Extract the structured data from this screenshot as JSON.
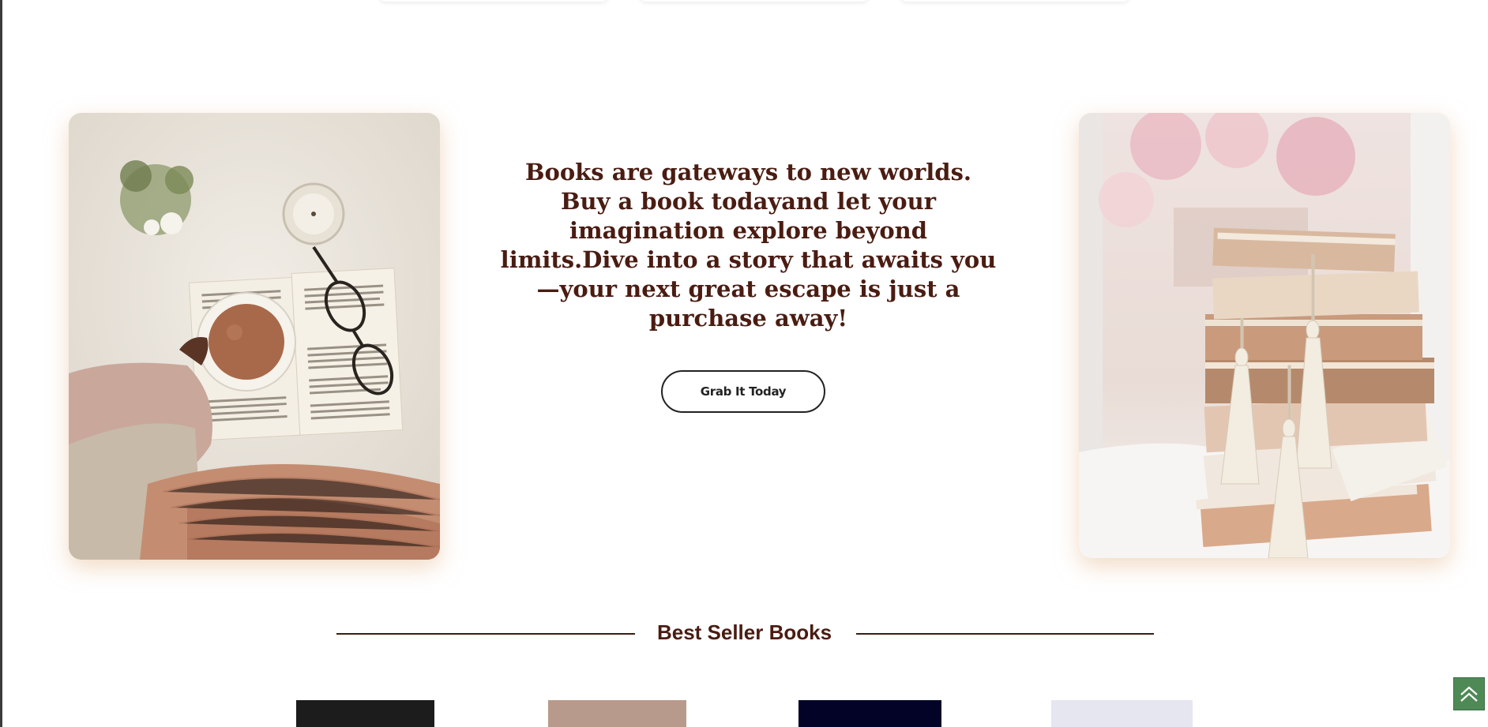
{
  "hero": {
    "quote": "Books are gateways to new worlds. Buy a book todayand let your imagination explore beyond limits.Dive into a story that awaits you—your next great escape is just a purchase away!",
    "cta_label": "Grab It Today"
  },
  "bestsellers": {
    "title": "Best Seller Books",
    "books": [
      {
        "cover_color": "#1c1c1c"
      },
      {
        "cover_color": "#b89a8c"
      },
      {
        "cover_color": "#020326"
      },
      {
        "cover_color": "#e6e6f0"
      }
    ]
  },
  "colors": {
    "heading": "#4a1c12",
    "accent_glow": "#e8be96",
    "scroll_button": "#4f8a56"
  },
  "icons": {
    "scroll_top": "double-chevron-up-icon"
  }
}
